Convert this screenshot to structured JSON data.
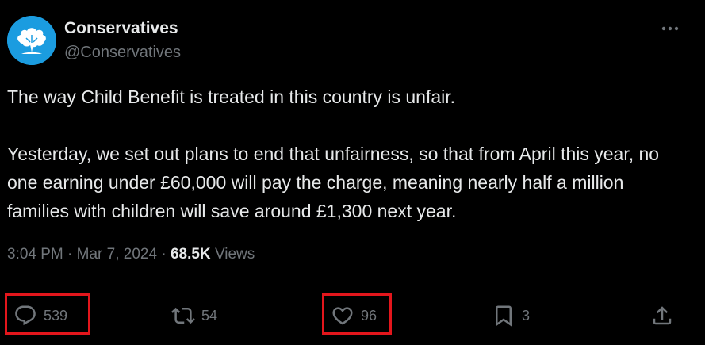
{
  "author": {
    "display_name": "Conservatives",
    "handle": "@Conservatives",
    "avatar_icon": "oak-tree-logo-icon",
    "avatar_color": "#1b9ce0"
  },
  "tweet": {
    "text": "The way Child Benefit is treated in this country is unfair.\n\nYesterday, we set out plans to end that unfairness, so that from April this year, no one earning under £60,000 will pay the charge, meaning nearly half a million families with children will save around £1,300 next year.",
    "time": "3:04 PM",
    "date": "Mar 7, 2024",
    "views_count": "68.5K",
    "views_label": "Views"
  },
  "actions": {
    "reply_count": "539",
    "retweet_count": "54",
    "like_count": "96",
    "bookmark_count": "3"
  },
  "colors": {
    "background": "#000000",
    "text": "#e7e9ea",
    "muted": "#71767b",
    "highlight_box": "#e3161c"
  }
}
